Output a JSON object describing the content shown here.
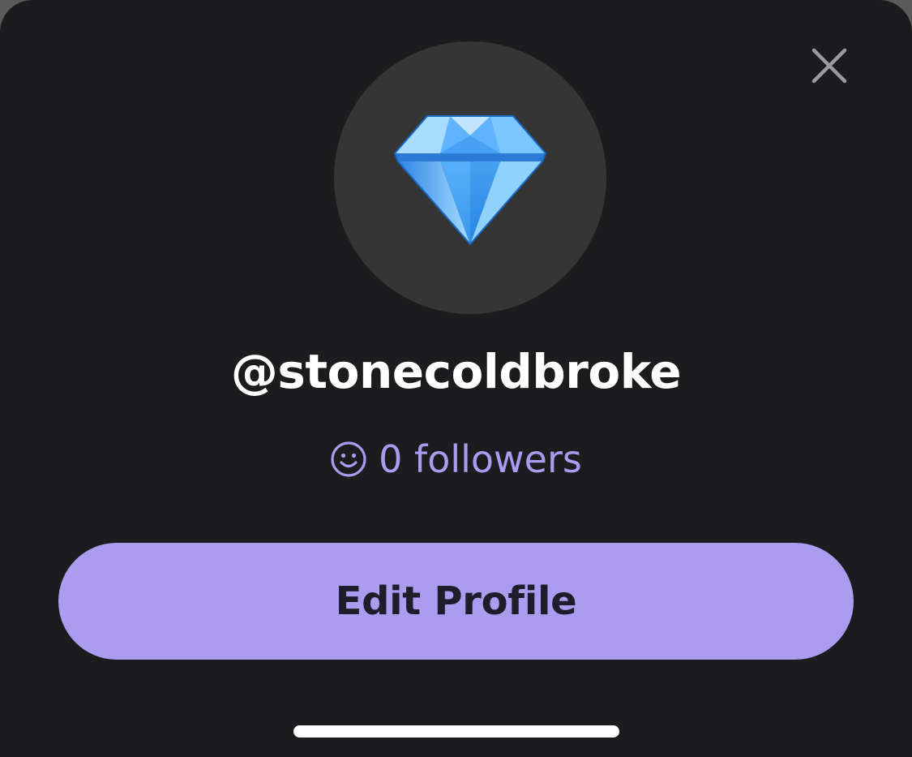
{
  "profile": {
    "username": "@stonecoldbroke",
    "followers_text": "0 followers",
    "avatar_icon": "gem-stone-icon"
  },
  "actions": {
    "edit_profile_label": "Edit Profile",
    "close_icon": "close-icon"
  },
  "colors": {
    "background": "#1c1c1e",
    "avatar_bg": "#353535",
    "accent": "#ab9cf0",
    "followers_text": "#a99cf0",
    "button_text": "#1f1d2b"
  }
}
